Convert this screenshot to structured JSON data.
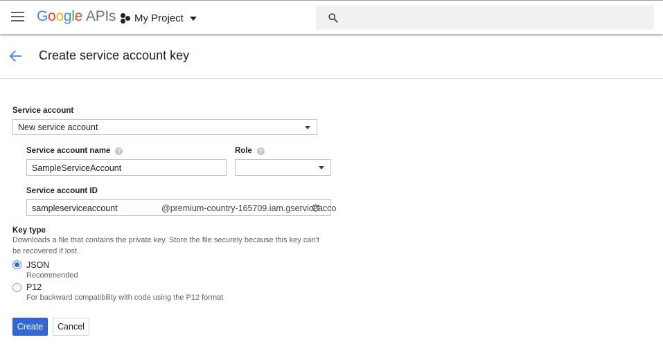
{
  "topbar": {
    "logo_letters": [
      "G",
      "o",
      "o",
      "g",
      "l",
      "e"
    ],
    "logo_suffix": "APIs",
    "project_name": "My Project",
    "search_placeholder": ""
  },
  "header": {
    "title": "Create service account key"
  },
  "form": {
    "service_account": {
      "label": "Service account",
      "selected": "New service account"
    },
    "service_account_name": {
      "label": "Service account name",
      "value": "SampleServiceAccount"
    },
    "role": {
      "label": "Role",
      "selected": ""
    },
    "service_account_id": {
      "label": "Service account ID",
      "value": "sampleserviceaccount",
      "suffix": "@premium-country-165709.iam.gserviceacco"
    },
    "key_type": {
      "label": "Key type",
      "description": "Downloads a file that contains the private key. Store the file securely because this key can't be recovered if lost.",
      "options": [
        {
          "label": "JSON",
          "sub": "Recommended",
          "checked": true
        },
        {
          "label": "P12",
          "sub": "For backward compatibility with code using the P12 format",
          "checked": false
        }
      ]
    }
  },
  "actions": {
    "create_label": "Create",
    "cancel_label": "Cancel"
  },
  "colors": {
    "primary": "#3367d6",
    "link_blue": "#4285f4"
  }
}
